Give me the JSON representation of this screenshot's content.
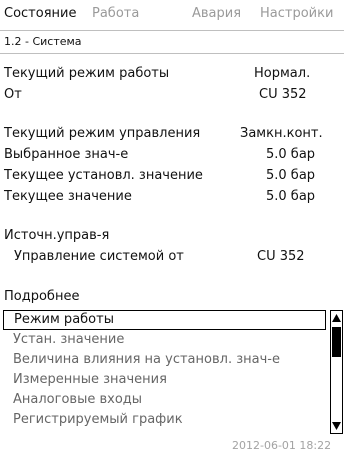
{
  "tabs": [
    {
      "label": "Состояние",
      "active": true
    },
    {
      "label": "Работа",
      "active": false
    },
    {
      "label": "Авария",
      "active": false
    },
    {
      "label": "Настройки",
      "active": false
    }
  ],
  "screen_title": "1.2 - Система",
  "operation": {
    "mode_label": "Текущий режим работы",
    "mode_value": "Нормал.",
    "from_label": "От",
    "from_value": "CU 352"
  },
  "control": {
    "mode_label": "Текущий режим управления",
    "mode_value": "Замкн.конт.",
    "selected_label": "Выбранное знач-е",
    "selected_value": "5.0 бар",
    "setpoint_label": "Текущее установл. значение",
    "setpoint_value": "5.0 бар",
    "current_label": "Текущее значение",
    "current_value": "5.0 бар"
  },
  "source": {
    "title": "Источн.управ-я",
    "system_label": "Управление системой от",
    "system_value": "CU 352"
  },
  "details": {
    "title": "Подробнее",
    "items": [
      {
        "label": "Режим работы",
        "selected": true
      },
      {
        "label": "Устан. значение",
        "selected": false
      },
      {
        "label": "Величина влияния на установл. знач-е",
        "selected": false
      },
      {
        "label": "Измеренные значения",
        "selected": false
      },
      {
        "label": "Аналоговые входы",
        "selected": false
      },
      {
        "label": "Регистрируемый график",
        "selected": false
      }
    ]
  },
  "status_bar": {
    "datetime": "2012-06-01 18:22"
  },
  "icons": {
    "scroll_up": "arrow-up-icon",
    "scroll_down": "arrow-down-icon"
  }
}
